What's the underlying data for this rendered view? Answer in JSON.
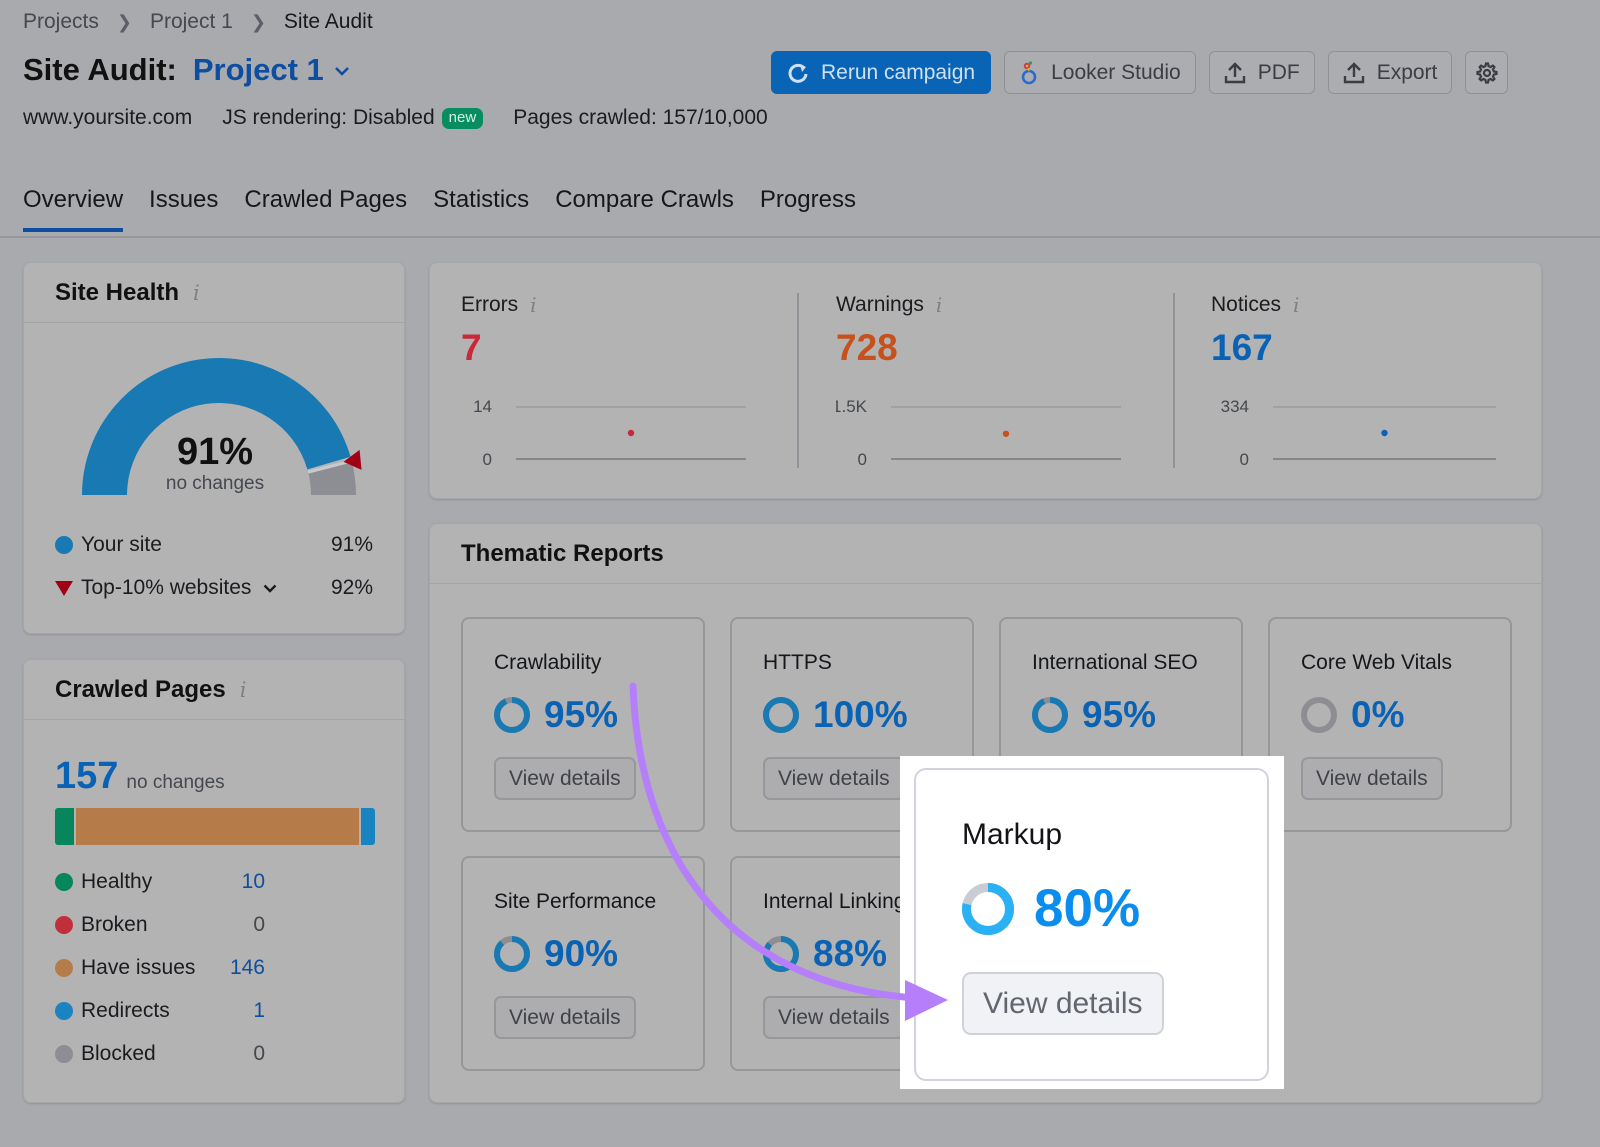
{
  "breadcrumb": [
    "Projects",
    "Project 1",
    "Site Audit"
  ],
  "header": {
    "title_static": "Site Audit:",
    "project_name": "Project 1",
    "domain": "www.yoursite.com",
    "js_rendering": "JS rendering: Disabled",
    "js_badge": "new",
    "pages_crawled": "Pages crawled: 157/10,000"
  },
  "toolbar": {
    "rerun_label": "Rerun campaign",
    "looker_label": "Looker Studio",
    "pdf_label": "PDF",
    "export_label": "Export"
  },
  "tabs": [
    {
      "label": "Overview",
      "active": true
    },
    {
      "label": "Issues",
      "active": false
    },
    {
      "label": "Crawled Pages",
      "active": false
    },
    {
      "label": "Statistics",
      "active": false
    },
    {
      "label": "Compare Crawls",
      "active": false
    },
    {
      "label": "Progress",
      "active": false
    }
  ],
  "site_health": {
    "title": "Site Health",
    "info": "i",
    "score": 91,
    "score_label": "91%",
    "change_label": "no changes",
    "benchmark": 92,
    "legend": [
      {
        "label": "Your site",
        "value": "91%",
        "color": "#1879b3"
      },
      {
        "label": "Top-10% websites",
        "value": "92%",
        "color": "#a10014"
      }
    ],
    "colors": {
      "fill": "#1879b3",
      "rest": "#8d8e93"
    }
  },
  "crawled_pages": {
    "title": "Crawled Pages",
    "info": "i",
    "total": "157",
    "change_label": "no changes",
    "segments": [
      {
        "label": "Healthy",
        "value": 10,
        "color": "#07855c",
        "link": true
      },
      {
        "label": "Broken",
        "value": 0,
        "color": "#c0303b",
        "link": false
      },
      {
        "label": "Have issues",
        "value": 146,
        "color": "#b57c4a",
        "link": true
      },
      {
        "label": "Redirects",
        "value": 1,
        "color": "#1a83c2",
        "link": true
      },
      {
        "label": "Blocked",
        "value": 0,
        "color": "#8d8e93",
        "link": false
      }
    ]
  },
  "issues": [
    {
      "label": "Errors",
      "value": "7",
      "count": 7,
      "axis_max": 14,
      "axis_max_label": "14",
      "axis_min_label": "0",
      "color": "#c8283a"
    },
    {
      "label": "Warnings",
      "value": "728",
      "count": 728,
      "axis_max": 1500,
      "axis_max_label": "1.5K",
      "axis_min_label": "0",
      "color": "#c7511c"
    },
    {
      "label": "Notices",
      "value": "167",
      "count": 167,
      "axis_max": 334,
      "axis_max_label": "334",
      "axis_min_label": "0",
      "color": "#0a62b4"
    }
  ],
  "thematic": {
    "title": "Thematic Reports",
    "button_label": "View details",
    "reports": [
      {
        "name": "Crawlability",
        "score": 95,
        "label": "95%"
      },
      {
        "name": "HTTPS",
        "score": 100,
        "label": "100%"
      },
      {
        "name": "International SEO",
        "score": 95,
        "label": "95%"
      },
      {
        "name": "Core Web Vitals",
        "score": 0,
        "label": "0%"
      },
      {
        "name": "Site Performance",
        "score": 90,
        "label": "90%"
      },
      {
        "name": "Internal Linking",
        "score": 88,
        "label": "88%"
      }
    ],
    "highlight": {
      "name": "Markup",
      "score": 80,
      "label": "80%",
      "button_label": "View details"
    }
  },
  "colors": {
    "primary": "#0a64b5",
    "ring_fill": "#1879b3",
    "ring_rest": "#8d8e93",
    "hl_ring_fill": "#29b0f5",
    "hl_ring_rest": "#c9ccd3",
    "arrow": "#b57ffb"
  }
}
